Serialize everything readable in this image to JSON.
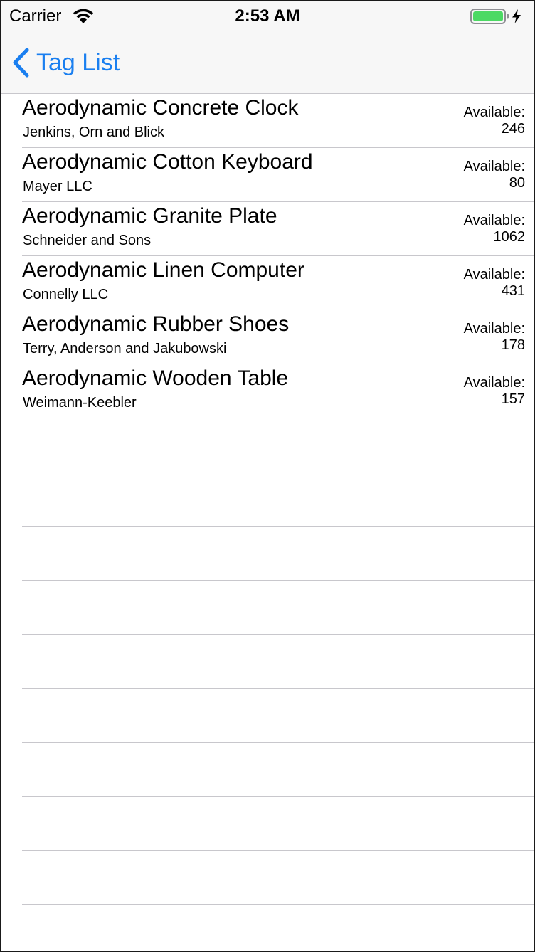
{
  "status_bar": {
    "carrier": "Carrier",
    "time": "2:53 AM",
    "wifi_icon": "wifi-icon",
    "battery_icon": "battery-charging-icon",
    "battery_color": "#4cd964"
  },
  "nav_bar": {
    "back_label": "Tag List",
    "back_icon": "chevron-left-icon",
    "tint_color": "#1a7ff0"
  },
  "list": {
    "items": [
      {
        "title": "Aerodynamic Concrete Clock",
        "subtitle": "Jenkins, Orn and Blick",
        "available_label": "Available:",
        "available_count": "246"
      },
      {
        "title": "Aerodynamic Cotton Keyboard",
        "subtitle": "Mayer LLC",
        "available_label": "Available:",
        "available_count": "80"
      },
      {
        "title": "Aerodynamic Granite Plate",
        "subtitle": "Schneider and Sons",
        "available_label": "Available:",
        "available_count": "1062"
      },
      {
        "title": "Aerodynamic Linen Computer",
        "subtitle": "Connelly LLC",
        "available_label": "Available:",
        "available_count": "431"
      },
      {
        "title": "Aerodynamic Rubber Shoes",
        "subtitle": "Terry, Anderson and Jakubowski",
        "available_label": "Available:",
        "available_count": "178"
      },
      {
        "title": "Aerodynamic Wooden Table",
        "subtitle": "Weimann-Keebler",
        "available_label": "Available:",
        "available_count": "157"
      }
    ]
  }
}
